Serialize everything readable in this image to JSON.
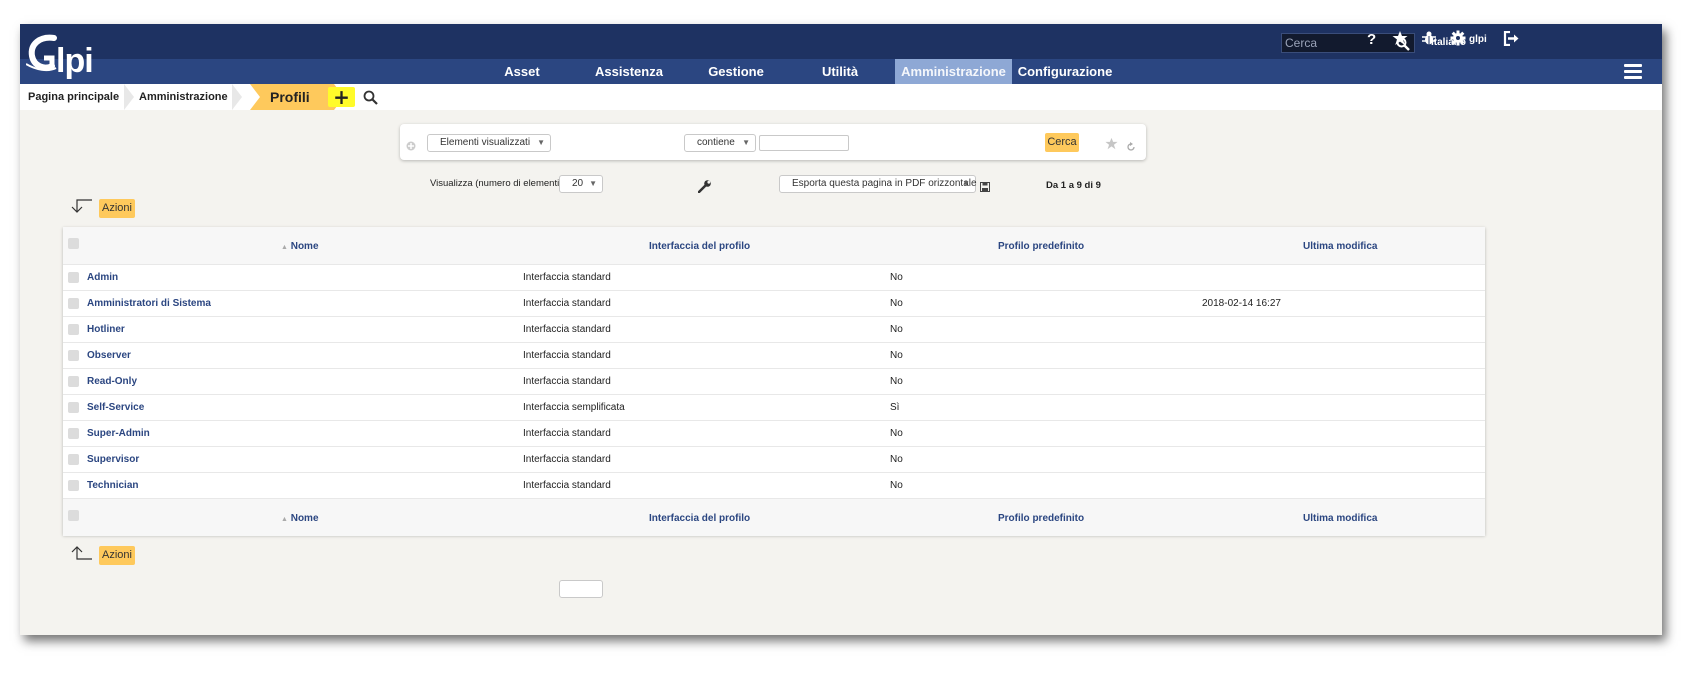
{
  "app": {
    "logo_text": "Glpi"
  },
  "topbar": {
    "search_placeholder": "Cerca",
    "language": "Italiano",
    "user": "glpi",
    "icons": [
      "help-icon",
      "star-icon",
      "bug-icon",
      "gear-icon",
      "logout-icon"
    ]
  },
  "nav": {
    "items": [
      "Asset",
      "Assistenza",
      "Gestione",
      "Utilità",
      "Amministrazione",
      "Configurazione"
    ],
    "active": "Amministrazione"
  },
  "breadcrumb": {
    "home": "Pagina principale",
    "section": "Amministrazione",
    "current": "Profili",
    "add_label": "+"
  },
  "search": {
    "field": "Elementi visualizzati",
    "operator": "contiene",
    "value": "",
    "button": "Cerca"
  },
  "list_controls": {
    "display_label": "Visualizza (numero di elementi)",
    "per_page": "20",
    "export": "Esporta questa pagina in PDF orizzontale",
    "pager": "Da 1 a 9 di 9",
    "actions_label": "Azioni"
  },
  "table": {
    "columns": [
      "Nome",
      "Interfaccia del profilo",
      "Profilo predefinito",
      "Ultima modifica"
    ],
    "sort_indicator": "▲",
    "rows": [
      [
        "Admin",
        "Interfaccia standard",
        "No",
        ""
      ],
      [
        "Amministratori di Sistema",
        "Interfaccia standard",
        "No",
        "2018-02-14 16:27"
      ],
      [
        "Hotliner",
        "Interfaccia standard",
        "No",
        ""
      ],
      [
        "Observer",
        "Interfaccia standard",
        "No",
        ""
      ],
      [
        "Read-Only",
        "Interfaccia standard",
        "No",
        ""
      ],
      [
        "Self-Service",
        "Interfaccia semplificata",
        "Sì",
        ""
      ],
      [
        "Super-Admin",
        "Interfaccia standard",
        "No",
        ""
      ],
      [
        "Supervisor",
        "Interfaccia standard",
        "No",
        ""
      ],
      [
        "Technician",
        "Interfaccia standard",
        "No",
        ""
      ]
    ]
  },
  "colors": {
    "header_dark": "#1e3262",
    "nav": "#2b4681",
    "nav_active": "#8ea8d5",
    "accent_yellow": "#fec95c",
    "link": "#2b4681"
  }
}
